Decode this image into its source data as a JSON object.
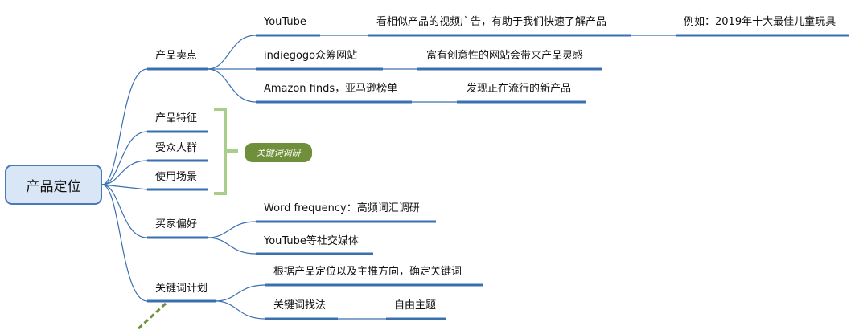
{
  "root": {
    "label": "产品定位"
  },
  "branches": [
    {
      "label": "产品卖点",
      "children": [
        {
          "label": "YouTube",
          "children": [
            {
              "label": "看相似产品的视频广告，有助于我们快速了解产品",
              "children": [
                {
                  "label": "例如：2019年十大最佳儿童玩具"
                }
              ]
            }
          ]
        },
        {
          "label": "indiegogo众筹网站",
          "children": [
            {
              "label": "富有创意性的网站会带来产品灵感"
            }
          ]
        },
        {
          "label": "Amazon finds，亚马逊榜单",
          "children": [
            {
              "label": "发现正在流行的新产品"
            }
          ]
        }
      ]
    },
    {
      "label": "产品特征"
    },
    {
      "label": "受众人群"
    },
    {
      "label": "使用场景"
    },
    {
      "label": "买家偏好",
      "children": [
        {
          "label": "Word frequency：高频词汇调研"
        },
        {
          "label": "YouTube等社交媒体"
        }
      ]
    },
    {
      "label": "关键词计划",
      "children": [
        {
          "label": "根据产品定位以及主推方向，确定关键词"
        },
        {
          "label": "关键词找法",
          "children": [
            {
              "label": "自由主题"
            }
          ]
        }
      ]
    }
  ],
  "summary": {
    "label": "关键词调研",
    "covers": [
      "产品特征",
      "受众人群",
      "使用场景"
    ]
  },
  "colors": {
    "line": "#3a6fb0",
    "bracket": "#a9cd8a",
    "tag": "#6f8f3a",
    "root_fill": "#d9e6f6",
    "root_border": "#4a78b8"
  }
}
